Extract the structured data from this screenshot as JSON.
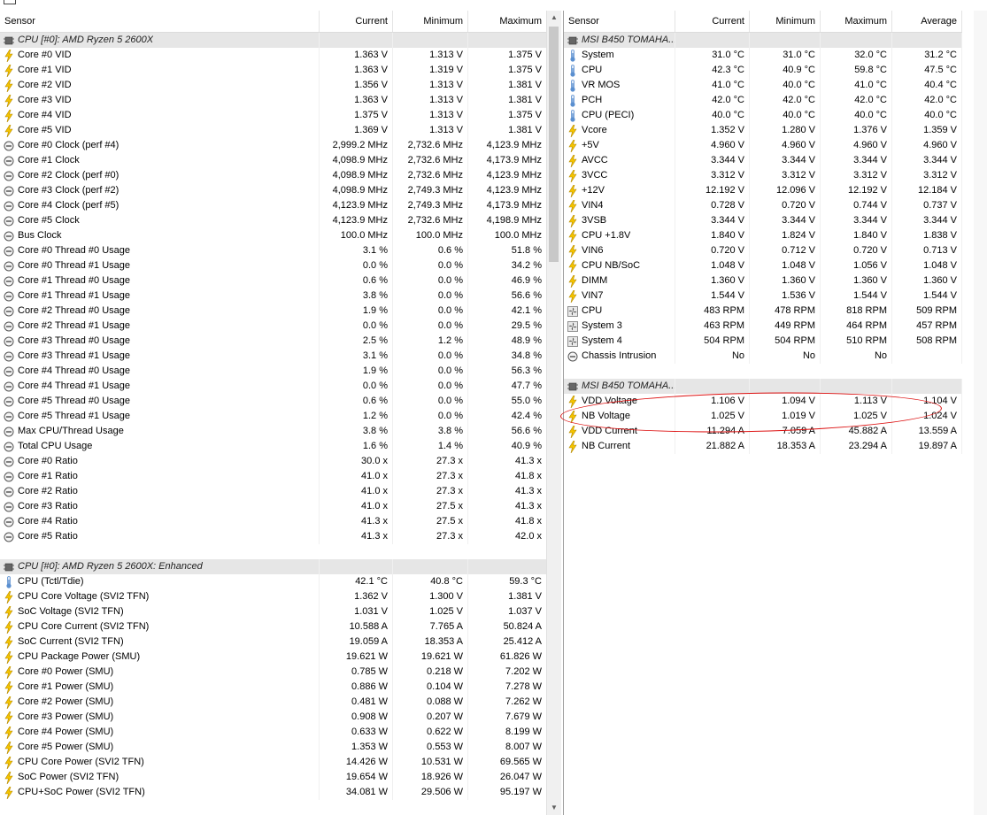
{
  "headers": {
    "left": [
      "Sensor",
      "Current",
      "Minimum",
      "Maximum"
    ],
    "right": [
      "Sensor",
      "Current",
      "Minimum",
      "Maximum",
      "Average"
    ]
  },
  "icon_types": {
    "chip": "chip-icon",
    "volt": "lightning-icon",
    "clock": "clock-icon",
    "temp": "thermometer-icon",
    "fan": "fan-icon"
  },
  "colors": {
    "group_bg": "#e6e6e6",
    "volt": "#f5c400",
    "temp": "#5a8fd0",
    "highlight_circle": "#dd1111"
  },
  "left": [
    {
      "group": true,
      "icon": "chip",
      "name": "CPU [#0]: AMD Ryzen 5 2600X"
    },
    {
      "icon": "volt",
      "name": "Core #0 VID",
      "v": [
        "1.363 V",
        "1.313 V",
        "1.375 V"
      ]
    },
    {
      "icon": "volt",
      "name": "Core #1 VID",
      "v": [
        "1.363 V",
        "1.319 V",
        "1.375 V"
      ]
    },
    {
      "icon": "volt",
      "name": "Core #2 VID",
      "v": [
        "1.356 V",
        "1.313 V",
        "1.381 V"
      ]
    },
    {
      "icon": "volt",
      "name": "Core #3 VID",
      "v": [
        "1.363 V",
        "1.313 V",
        "1.381 V"
      ]
    },
    {
      "icon": "volt",
      "name": "Core #4 VID",
      "v": [
        "1.375 V",
        "1.313 V",
        "1.375 V"
      ]
    },
    {
      "icon": "volt",
      "name": "Core #5 VID",
      "v": [
        "1.369 V",
        "1.313 V",
        "1.381 V"
      ]
    },
    {
      "icon": "clock",
      "name": "Core #0 Clock (perf #4)",
      "v": [
        "2,999.2 MHz",
        "2,732.6 MHz",
        "4,123.9 MHz"
      ]
    },
    {
      "icon": "clock",
      "name": "Core #1 Clock",
      "v": [
        "4,098.9 MHz",
        "2,732.6 MHz",
        "4,173.9 MHz"
      ]
    },
    {
      "icon": "clock",
      "name": "Core #2 Clock (perf #0)",
      "v": [
        "4,098.9 MHz",
        "2,732.6 MHz",
        "4,123.9 MHz"
      ]
    },
    {
      "icon": "clock",
      "name": "Core #3 Clock (perf #2)",
      "v": [
        "4,098.9 MHz",
        "2,749.3 MHz",
        "4,123.9 MHz"
      ]
    },
    {
      "icon": "clock",
      "name": "Core #4 Clock (perf #5)",
      "v": [
        "4,123.9 MHz",
        "2,749.3 MHz",
        "4,173.9 MHz"
      ]
    },
    {
      "icon": "clock",
      "name": "Core #5 Clock",
      "v": [
        "4,123.9 MHz",
        "2,732.6 MHz",
        "4,198.9 MHz"
      ]
    },
    {
      "icon": "clock",
      "name": "Bus Clock",
      "v": [
        "100.0 MHz",
        "100.0 MHz",
        "100.0 MHz"
      ]
    },
    {
      "icon": "clock",
      "name": "Core #0 Thread #0 Usage",
      "v": [
        "3.1 %",
        "0.6 %",
        "51.8 %"
      ]
    },
    {
      "icon": "clock",
      "name": "Core #0 Thread #1 Usage",
      "v": [
        "0.0 %",
        "0.0 %",
        "34.2 %"
      ]
    },
    {
      "icon": "clock",
      "name": "Core #1 Thread #0 Usage",
      "v": [
        "0.6 %",
        "0.0 %",
        "46.9 %"
      ]
    },
    {
      "icon": "clock",
      "name": "Core #1 Thread #1 Usage",
      "v": [
        "3.8 %",
        "0.0 %",
        "56.6 %"
      ]
    },
    {
      "icon": "clock",
      "name": "Core #2 Thread #0 Usage",
      "v": [
        "1.9 %",
        "0.0 %",
        "42.1 %"
      ]
    },
    {
      "icon": "clock",
      "name": "Core #2 Thread #1 Usage",
      "v": [
        "0.0 %",
        "0.0 %",
        "29.5 %"
      ]
    },
    {
      "icon": "clock",
      "name": "Core #3 Thread #0 Usage",
      "v": [
        "2.5 %",
        "1.2 %",
        "48.9 %"
      ]
    },
    {
      "icon": "clock",
      "name": "Core #3 Thread #1 Usage",
      "v": [
        "3.1 %",
        "0.0 %",
        "34.8 %"
      ]
    },
    {
      "icon": "clock",
      "name": "Core #4 Thread #0 Usage",
      "v": [
        "1.9 %",
        "0.0 %",
        "56.3 %"
      ]
    },
    {
      "icon": "clock",
      "name": "Core #4 Thread #1 Usage",
      "v": [
        "0.0 %",
        "0.0 %",
        "47.7 %"
      ]
    },
    {
      "icon": "clock",
      "name": "Core #5 Thread #0 Usage",
      "v": [
        "0.6 %",
        "0.0 %",
        "55.0 %"
      ]
    },
    {
      "icon": "clock",
      "name": "Core #5 Thread #1 Usage",
      "v": [
        "1.2 %",
        "0.0 %",
        "42.4 %"
      ]
    },
    {
      "icon": "clock",
      "name": "Max CPU/Thread Usage",
      "v": [
        "3.8 %",
        "3.8 %",
        "56.6 %"
      ]
    },
    {
      "icon": "clock",
      "name": "Total CPU Usage",
      "v": [
        "1.6 %",
        "1.4 %",
        "40.9 %"
      ]
    },
    {
      "icon": "clock",
      "name": "Core #0 Ratio",
      "v": [
        "30.0 x",
        "27.3 x",
        "41.3 x"
      ]
    },
    {
      "icon": "clock",
      "name": "Core #1 Ratio",
      "v": [
        "41.0 x",
        "27.3 x",
        "41.8 x"
      ]
    },
    {
      "icon": "clock",
      "name": "Core #2 Ratio",
      "v": [
        "41.0 x",
        "27.3 x",
        "41.3 x"
      ]
    },
    {
      "icon": "clock",
      "name": "Core #3 Ratio",
      "v": [
        "41.0 x",
        "27.5 x",
        "41.3 x"
      ]
    },
    {
      "icon": "clock",
      "name": "Core #4 Ratio",
      "v": [
        "41.3 x",
        "27.5 x",
        "41.8 x"
      ]
    },
    {
      "icon": "clock",
      "name": "Core #5 Ratio",
      "v": [
        "41.3 x",
        "27.3 x",
        "42.0 x"
      ]
    },
    {
      "blank": true
    },
    {
      "group": true,
      "icon": "chip",
      "name": "CPU [#0]: AMD Ryzen 5 2600X: Enhanced"
    },
    {
      "icon": "temp",
      "name": "CPU (Tctl/Tdie)",
      "v": [
        "42.1 °C",
        "40.8 °C",
        "59.3 °C"
      ]
    },
    {
      "icon": "volt",
      "name": "CPU Core Voltage (SVI2 TFN)",
      "v": [
        "1.362 V",
        "1.300 V",
        "1.381 V"
      ]
    },
    {
      "icon": "volt",
      "name": "SoC Voltage (SVI2 TFN)",
      "v": [
        "1.031 V",
        "1.025 V",
        "1.037 V"
      ]
    },
    {
      "icon": "volt",
      "name": "CPU Core Current (SVI2 TFN)",
      "v": [
        "10.588 A",
        "7.765 A",
        "50.824 A"
      ]
    },
    {
      "icon": "volt",
      "name": "SoC Current (SVI2 TFN)",
      "v": [
        "19.059 A",
        "18.353 A",
        "25.412 A"
      ]
    },
    {
      "icon": "volt",
      "name": "CPU Package Power (SMU)",
      "v": [
        "19.621 W",
        "19.621 W",
        "61.826 W"
      ]
    },
    {
      "icon": "volt",
      "name": "Core #0 Power (SMU)",
      "v": [
        "0.785 W",
        "0.218 W",
        "7.202 W"
      ]
    },
    {
      "icon": "volt",
      "name": "Core #1 Power (SMU)",
      "v": [
        "0.886 W",
        "0.104 W",
        "7.278 W"
      ]
    },
    {
      "icon": "volt",
      "name": "Core #2 Power (SMU)",
      "v": [
        "0.481 W",
        "0.088 W",
        "7.262 W"
      ]
    },
    {
      "icon": "volt",
      "name": "Core #3 Power (SMU)",
      "v": [
        "0.908 W",
        "0.207 W",
        "7.679 W"
      ]
    },
    {
      "icon": "volt",
      "name": "Core #4 Power (SMU)",
      "v": [
        "0.633 W",
        "0.622 W",
        "8.199 W"
      ]
    },
    {
      "icon": "volt",
      "name": "Core #5 Power (SMU)",
      "v": [
        "1.353 W",
        "0.553 W",
        "8.007 W"
      ]
    },
    {
      "icon": "volt",
      "name": "CPU Core Power (SVI2 TFN)",
      "v": [
        "14.426 W",
        "10.531 W",
        "69.565 W"
      ]
    },
    {
      "icon": "volt",
      "name": "SoC Power (SVI2 TFN)",
      "v": [
        "19.654 W",
        "18.926 W",
        "26.047 W"
      ]
    },
    {
      "icon": "volt",
      "name": "CPU+SoC Power (SVI2 TFN)",
      "v": [
        "34.081 W",
        "29.506 W",
        "95.197 W"
      ]
    }
  ],
  "right": [
    {
      "group": true,
      "icon": "chip",
      "name": "MSI B450 TOMAHA..."
    },
    {
      "icon": "temp",
      "name": "System",
      "v": [
        "31.0 °C",
        "31.0 °C",
        "32.0 °C",
        "31.2 °C"
      ]
    },
    {
      "icon": "temp",
      "name": "CPU",
      "v": [
        "42.3 °C",
        "40.9 °C",
        "59.8 °C",
        "47.5 °C"
      ]
    },
    {
      "icon": "temp",
      "name": "VR MOS",
      "v": [
        "41.0 °C",
        "40.0 °C",
        "41.0 °C",
        "40.4 °C"
      ]
    },
    {
      "icon": "temp",
      "name": "PCH",
      "v": [
        "42.0 °C",
        "42.0 °C",
        "42.0 °C",
        "42.0 °C"
      ]
    },
    {
      "icon": "temp",
      "name": "CPU (PECI)",
      "v": [
        "40.0 °C",
        "40.0 °C",
        "40.0 °C",
        "40.0 °C"
      ]
    },
    {
      "icon": "volt",
      "name": "Vcore",
      "v": [
        "1.352 V",
        "1.280 V",
        "1.376 V",
        "1.359 V"
      ]
    },
    {
      "icon": "volt",
      "name": "+5V",
      "v": [
        "4.960 V",
        "4.960 V",
        "4.960 V",
        "4.960 V"
      ]
    },
    {
      "icon": "volt",
      "name": "AVCC",
      "v": [
        "3.344 V",
        "3.344 V",
        "3.344 V",
        "3.344 V"
      ]
    },
    {
      "icon": "volt",
      "name": "3VCC",
      "v": [
        "3.312 V",
        "3.312 V",
        "3.312 V",
        "3.312 V"
      ]
    },
    {
      "icon": "volt",
      "name": "+12V",
      "v": [
        "12.192 V",
        "12.096 V",
        "12.192 V",
        "12.184 V"
      ]
    },
    {
      "icon": "volt",
      "name": "VIN4",
      "v": [
        "0.728 V",
        "0.720 V",
        "0.744 V",
        "0.737 V"
      ]
    },
    {
      "icon": "volt",
      "name": "3VSB",
      "v": [
        "3.344 V",
        "3.344 V",
        "3.344 V",
        "3.344 V"
      ]
    },
    {
      "icon": "volt",
      "name": "CPU +1.8V",
      "v": [
        "1.840 V",
        "1.824 V",
        "1.840 V",
        "1.838 V"
      ]
    },
    {
      "icon": "volt",
      "name": "VIN6",
      "v": [
        "0.720 V",
        "0.712 V",
        "0.720 V",
        "0.713 V"
      ]
    },
    {
      "icon": "volt",
      "name": "CPU NB/SoC",
      "v": [
        "1.048 V",
        "1.048 V",
        "1.056 V",
        "1.048 V"
      ]
    },
    {
      "icon": "volt",
      "name": "DIMM",
      "v": [
        "1.360 V",
        "1.360 V",
        "1.360 V",
        "1.360 V"
      ]
    },
    {
      "icon": "volt",
      "name": "VIN7",
      "v": [
        "1.544 V",
        "1.536 V",
        "1.544 V",
        "1.544 V"
      ]
    },
    {
      "icon": "fan",
      "name": "CPU",
      "v": [
        "483 RPM",
        "478 RPM",
        "818 RPM",
        "509 RPM"
      ]
    },
    {
      "icon": "fan",
      "name": "System 3",
      "v": [
        "463 RPM",
        "449 RPM",
        "464 RPM",
        "457 RPM"
      ]
    },
    {
      "icon": "fan",
      "name": "System 4",
      "v": [
        "504 RPM",
        "504 RPM",
        "510 RPM",
        "508 RPM"
      ]
    },
    {
      "icon": "clock",
      "name": "Chassis Intrusion",
      "v": [
        "No",
        "No",
        "No",
        ""
      ]
    },
    {
      "blank": true
    },
    {
      "group": true,
      "icon": "chip",
      "name": "MSI B450 TOMAHA..."
    },
    {
      "icon": "volt",
      "name": "VDD Voltage",
      "v": [
        "1.106 V",
        "1.094 V",
        "1.113 V",
        "1.104 V"
      ]
    },
    {
      "icon": "volt",
      "name": "NB Voltage",
      "v": [
        "1.025 V",
        "1.019 V",
        "1.025 V",
        "1.024 V"
      ]
    },
    {
      "icon": "volt",
      "name": "VDD Current",
      "v": [
        "11.294 A",
        "7.059 A",
        "45.882 A",
        "13.559 A"
      ]
    },
    {
      "icon": "volt",
      "name": "NB Current",
      "v": [
        "21.882 A",
        "18.353 A",
        "23.294 A",
        "19.897 A"
      ]
    }
  ]
}
